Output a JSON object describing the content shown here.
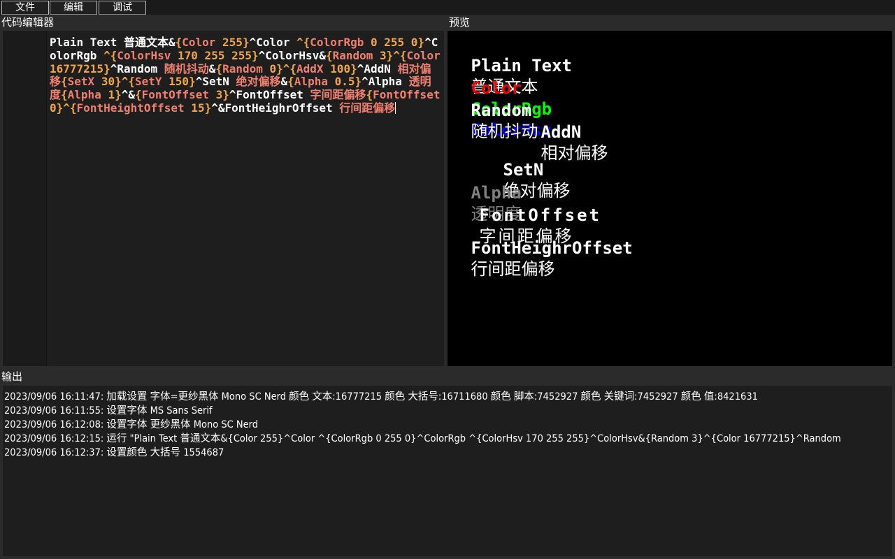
{
  "menu": {
    "items": [
      {
        "label": "文件"
      },
      {
        "label": "编辑"
      },
      {
        "label": "调试"
      }
    ]
  },
  "panels": {
    "editor_title": "代码编辑器",
    "preview_title": "预览",
    "output_title": "输出"
  },
  "editor": {
    "tokens": [
      {
        "t": "Plain Text 普通文本&",
        "c": "txt"
      },
      {
        "t": "{",
        "c": "br"
      },
      {
        "t": "Color",
        "c": "kw"
      },
      {
        "t": " 255",
        "c": "val"
      },
      {
        "t": "}",
        "c": "br"
      },
      {
        "t": "^Color ",
        "c": "txt"
      },
      {
        "t": "^{",
        "c": "br"
      },
      {
        "t": "ColorRgb",
        "c": "kw"
      },
      {
        "t": " 0 255 0",
        "c": "val"
      },
      {
        "t": "}",
        "c": "br"
      },
      {
        "t": "^ColorRgb ",
        "c": "txt"
      },
      {
        "t": "^{",
        "c": "br"
      },
      {
        "t": "ColorHsv",
        "c": "kw"
      },
      {
        "t": " 170 255 255",
        "c": "val"
      },
      {
        "t": "}",
        "c": "br"
      },
      {
        "t": "^ColorHsv&",
        "c": "txt"
      },
      {
        "t": "{",
        "c": "br"
      },
      {
        "t": "Random",
        "c": "kw"
      },
      {
        "t": " 3",
        "c": "val"
      },
      {
        "t": "}",
        "c": "br"
      },
      {
        "t": "^{",
        "c": "br"
      },
      {
        "t": "Color",
        "c": "kw"
      },
      {
        "t": " 16777215",
        "c": "val"
      },
      {
        "t": "}",
        "c": "br"
      },
      {
        "t": "^Random ",
        "c": "txt"
      },
      {
        "t": "随机抖动",
        "c": "kw"
      },
      {
        "t": "&",
        "c": "txt"
      },
      {
        "t": "{",
        "c": "br"
      },
      {
        "t": "Random",
        "c": "kw"
      },
      {
        "t": " 0",
        "c": "val"
      },
      {
        "t": "}",
        "c": "br"
      },
      {
        "t": "^{",
        "c": "br"
      },
      {
        "t": "AddX",
        "c": "kw"
      },
      {
        "t": " 100",
        "c": "val"
      },
      {
        "t": "}",
        "c": "br"
      },
      {
        "t": "^AddN ",
        "c": "txt"
      },
      {
        "t": "相对偏移",
        "c": "kw"
      },
      {
        "t": "{",
        "c": "br"
      },
      {
        "t": "SetX",
        "c": "kw"
      },
      {
        "t": " 30",
        "c": "val"
      },
      {
        "t": "}",
        "c": "br"
      },
      {
        "t": "^{",
        "c": "br"
      },
      {
        "t": "SetY",
        "c": "kw"
      },
      {
        "t": " 150",
        "c": "val"
      },
      {
        "t": "}",
        "c": "br"
      },
      {
        "t": "^SetN ",
        "c": "txt"
      },
      {
        "t": "绝对偏移",
        "c": "kw"
      },
      {
        "t": "&",
        "c": "txt"
      },
      {
        "t": "{",
        "c": "br"
      },
      {
        "t": "Alpha",
        "c": "kw"
      },
      {
        "t": " 0.5",
        "c": "val"
      },
      {
        "t": "}",
        "c": "br"
      },
      {
        "t": "^Alpha ",
        "c": "txt"
      },
      {
        "t": "透明度",
        "c": "kw"
      },
      {
        "t": "{",
        "c": "br"
      },
      {
        "t": "Alpha",
        "c": "kw"
      },
      {
        "t": " 1",
        "c": "val"
      },
      {
        "t": "}",
        "c": "br"
      },
      {
        "t": "^&",
        "c": "txt"
      },
      {
        "t": "{",
        "c": "br"
      },
      {
        "t": "FontOffset",
        "c": "kw"
      },
      {
        "t": " 3",
        "c": "val"
      },
      {
        "t": "}",
        "c": "br"
      },
      {
        "t": "^FontOffset ",
        "c": "txt"
      },
      {
        "t": "字间距偏移",
        "c": "kw"
      },
      {
        "t": "{",
        "c": "br"
      },
      {
        "t": "FontOffset",
        "c": "kw"
      },
      {
        "t": " 0",
        "c": "val"
      },
      {
        "t": "}",
        "c": "br"
      },
      {
        "t": "^{",
        "c": "br"
      },
      {
        "t": "FontHeightOffset",
        "c": "kw"
      },
      {
        "t": " 15",
        "c": "val"
      },
      {
        "t": "}",
        "c": "br"
      },
      {
        "t": "^&FontHeighrOffset ",
        "c": "txt"
      },
      {
        "t": "行间距偏移",
        "c": "kw"
      }
    ]
  },
  "preview": {
    "plain": {
      "en": "Plain Text",
      "zh": "普通文本"
    },
    "colors": {
      "c1": "Color",
      "c2": "ColorRgb",
      "c3": "ColorHsv",
      "col1": "#ff0000",
      "col2": "#00ff00",
      "col3": "#0000ff"
    },
    "random": {
      "en": "Random",
      "zh": "随机抖动"
    },
    "addn": {
      "en": "AddN",
      "zh": "相对偏移"
    },
    "setn": {
      "en": "SetN",
      "zh": "绝对偏移"
    },
    "alpha": {
      "en": "Alpha",
      "zh": "透明度",
      "color": "#808080"
    },
    "fontoffset": {
      "en": "FontOffset",
      "zh": "字间距偏移"
    },
    "fontheight": {
      "en": "FontHeighrOffset",
      "zh": "行间距偏移"
    }
  },
  "output": {
    "lines": [
      "2023/09/06 16:11:47: 加载设置 字体=更纱黑体 Mono SC Nerd 颜色 文本:16777215 颜色 大括号:16711680 颜色 脚本:7452927 颜色 关键词:7452927 颜色 值:8421631",
      "2023/09/06 16:11:55: 设置字体 MS Sans Serif",
      "2023/09/06 16:12:08: 设置字体 更纱黑体 Mono SC Nerd",
      "2023/09/06 16:12:15: 运行 \"Plain Text 普通文本&{Color 255}^Color ^{ColorRgb 0 255 0}^ColorRgb ^{ColorHsv 170 255 255}^ColorHsv&{Random 3}^{Color 16777215}^Random",
      "2023/09/06 16:12:37: 设置颜色 大括号 1554687"
    ]
  }
}
